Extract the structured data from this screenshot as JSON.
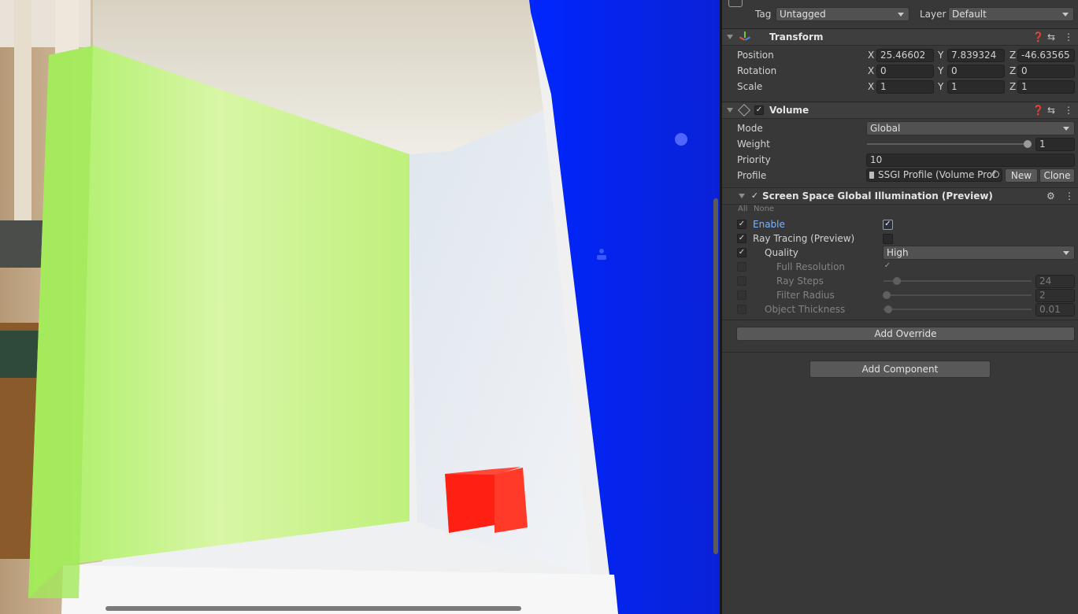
{
  "header": {
    "tag_label": "Tag",
    "tag_value": "Untagged",
    "layer_label": "Layer",
    "layer_value": "Default"
  },
  "transform": {
    "title": "Transform",
    "rows": [
      {
        "label": "Position",
        "x": "25.46602",
        "y": "7.839324",
        "z": "-46.63565"
      },
      {
        "label": "Rotation",
        "x": "0",
        "y": "0",
        "z": "0"
      },
      {
        "label": "Scale",
        "x": "1",
        "y": "1",
        "z": "1"
      }
    ],
    "axis_x": "X",
    "axis_y": "Y",
    "axis_z": "Z"
  },
  "volume": {
    "title": "Volume",
    "enabled": true,
    "mode_label": "Mode",
    "mode_value": "Global",
    "weight_label": "Weight",
    "weight_value": "1",
    "weight_fraction": 1.0,
    "priority_label": "Priority",
    "priority_value": "10",
    "profile_label": "Profile",
    "profile_value": "SSGI Profile (Volume Prof",
    "new_label": "New",
    "clone_label": "Clone"
  },
  "ssgi": {
    "title": "Screen Space Global Illumination (Preview)",
    "all_label": "All",
    "none_label": "None",
    "enable_label": "Enable",
    "ray_tracing_label": "Ray Tracing (Preview)",
    "quality_label": "Quality",
    "quality_value": "High",
    "full_resolution_label": "Full Resolution",
    "ray_steps_label": "Ray Steps",
    "ray_steps_value": "24",
    "filter_radius_label": "Filter Radius",
    "filter_radius_value": "2",
    "object_thickness_label": "Object Thickness",
    "object_thickness_value": "0.01"
  },
  "buttons": {
    "add_override": "Add Override",
    "add_component": "Add Component"
  },
  "icons": {
    "help": "help-icon",
    "presets": "presets-icon",
    "more": "more-icon"
  },
  "colors": {
    "wall_green": "#c8f07a",
    "wall_blue": "#0a1ef0",
    "cube_red": "#f01a10",
    "accent_blue": "#7cb4ff"
  }
}
